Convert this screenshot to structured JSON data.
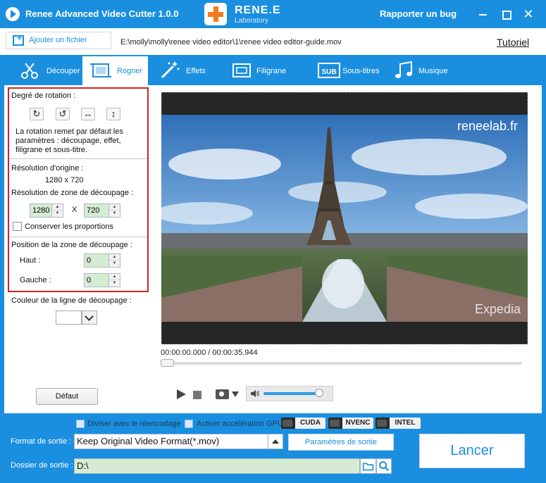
{
  "app": {
    "title": "Renee Advanced Video Cutter 1.0.0",
    "brand_name": "RENE.E",
    "brand_sub": "Laboratory",
    "report_bug": "Rapporter un bug",
    "close_glyph": "✕"
  },
  "addressbar": {
    "add_file_label": "Ajouter un fichier",
    "file_path": "E:\\molly\\molly\\renee video editor\\1\\renee video editor-guide.mov",
    "tutorial_link": "Tutoriel"
  },
  "tabs": [
    {
      "label": "Découper",
      "icon": "scissors-icon"
    },
    {
      "label": "Rogner",
      "icon": "crop-icon",
      "active": true
    },
    {
      "label": "Effets",
      "icon": "magic-wand-icon"
    },
    {
      "label": "Filigrane",
      "icon": "watermark-icon"
    },
    {
      "label": "Sous-titres",
      "icon": "subtitle-icon"
    },
    {
      "label": "Musique",
      "icon": "music-note-icon"
    }
  ],
  "crop_panel": {
    "rotation_title": "Degré de rotation :",
    "rotate_cw": "↻",
    "rotate_ccw": "↺",
    "flip_horizontal": "↔",
    "flip_vertical": "↕",
    "rotation_note": "La rotation remet par défaut les paramètres : découpage, effet, filigrane et sous-titre.",
    "origin_res_label": "Résolution d'origine :",
    "origin_res_value": "1280 x 720",
    "crop_res_label": "Résolution de zone de découpage :",
    "crop_width": "1280",
    "crop_height": "720",
    "crop_x": "X",
    "keep_ratio_label": "Conserver les proportions",
    "keep_ratio_checked": false,
    "position_label": "Position de la zone de découpage :",
    "top_label": "Haut :",
    "top_value": "0",
    "left_label": "Gauche :",
    "left_value": "0",
    "line_color_label": "Couleur de la ligne de découpage :",
    "line_color": "#ffffff",
    "default_button": "Défaut"
  },
  "player": {
    "watermark_text": "reneelab.fr",
    "logo_text": "Expedia",
    "time_display": "00:00:00.000 / 00:00:35.944",
    "volume_level": 0.9,
    "seek_position": 0
  },
  "output": {
    "split_reencode_label": "Diviser avec le réencodage",
    "gpu_accel_label": "Activer accélération GPU",
    "gpu_badges": [
      "CUDA",
      "NVENC",
      "INTEL"
    ],
    "format_label": "Format de sortie :",
    "format_value": "Keep Original Video Format(*.mov)",
    "params_button": "Paramètres de sortie",
    "folder_label": "Dossier de sortie :",
    "folder_value": "D:\\",
    "launch_button": "Lancer"
  },
  "colors": {
    "primary": "#1a8fe0",
    "highlight_border": "#c62828",
    "input_bg": "#d5ecd2",
    "brand_accent": "#f07c1f"
  }
}
